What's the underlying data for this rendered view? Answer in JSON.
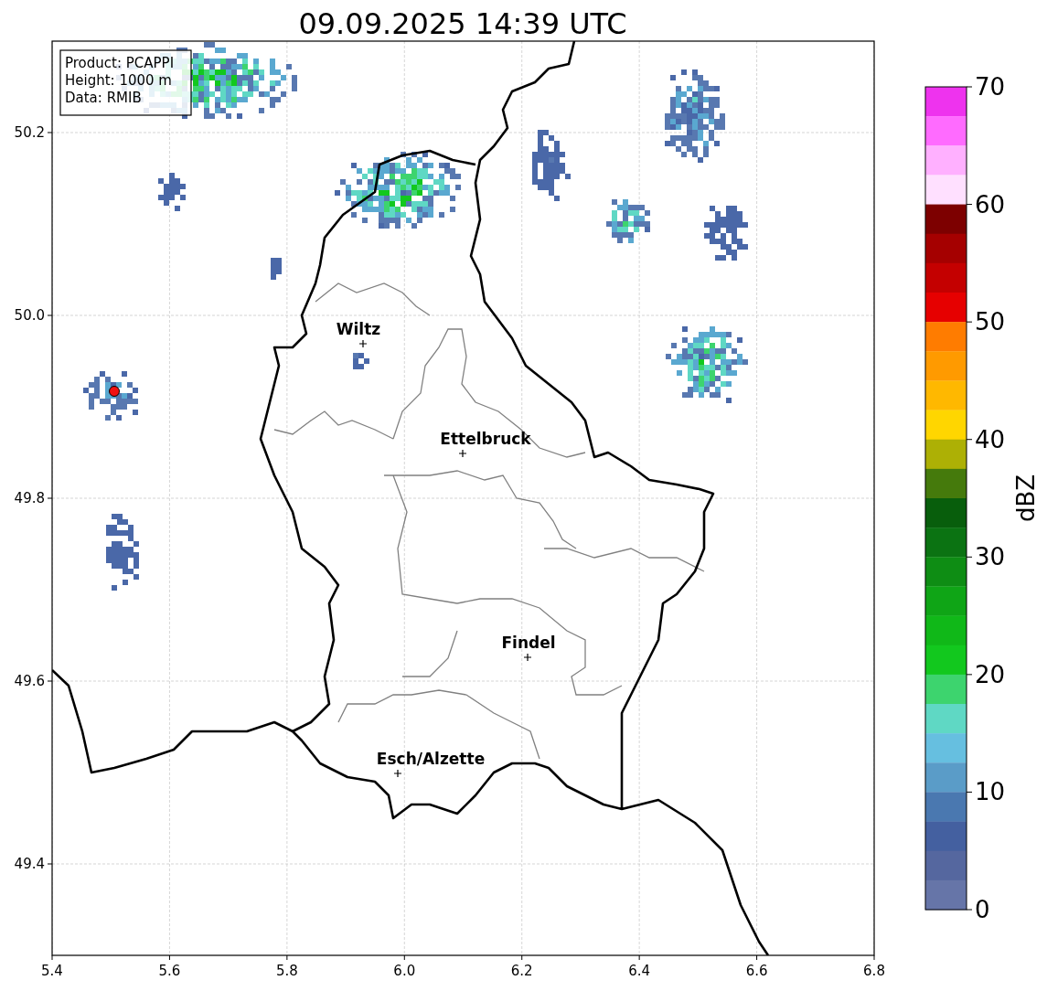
{
  "title": "09.09.2025 14:39 UTC",
  "info_box": [
    "Product: PCAPPI",
    "Height: 1000 m",
    "Data: RMIB"
  ],
  "map": {
    "x_ticks": [
      "5.4",
      "5.6",
      "5.8",
      "6.0",
      "6.2",
      "6.4",
      "6.6",
      "6.8"
    ],
    "y_ticks": [
      "50.2",
      "50.0",
      "49.8",
      "49.6",
      "49.4"
    ],
    "cities": [
      {
        "name": "Wiltz"
      },
      {
        "name": "Ettelbruck"
      },
      {
        "name": "Findel"
      },
      {
        "name": "Esch/Alzette"
      }
    ]
  },
  "colorbar": {
    "label": "dBZ",
    "ticks": [
      "70",
      "60",
      "50",
      "40",
      "30",
      "20",
      "10",
      "0"
    ],
    "bands": [
      {
        "color": "#ee33ee"
      },
      {
        "color": "#ff6bff"
      },
      {
        "color": "#ffb0ff"
      },
      {
        "color": "#ffe0ff"
      },
      {
        "color": "#7d0000"
      },
      {
        "color": "#a50000"
      },
      {
        "color": "#c40000"
      },
      {
        "color": "#e60000"
      },
      {
        "color": "#ff7c00"
      },
      {
        "color": "#ff9a00"
      },
      {
        "color": "#ffb800"
      },
      {
        "color": "#ffd600"
      },
      {
        "color": "#adb005"
      },
      {
        "color": "#457a0c"
      },
      {
        "color": "#085e0c"
      },
      {
        "color": "#0b7312"
      },
      {
        "color": "#0e8d14"
      },
      {
        "color": "#0fa516"
      },
      {
        "color": "#10b818"
      },
      {
        "color": "#12c81e"
      },
      {
        "color": "#3dd46e"
      },
      {
        "color": "#5fd8c4"
      },
      {
        "color": "#66bfe0"
      },
      {
        "color": "#5a9cc8"
      },
      {
        "color": "#4a78b0"
      },
      {
        "color": "#4460a0"
      },
      {
        "color": "#55679f"
      },
      {
        "color": "#6675a8"
      }
    ]
  }
}
